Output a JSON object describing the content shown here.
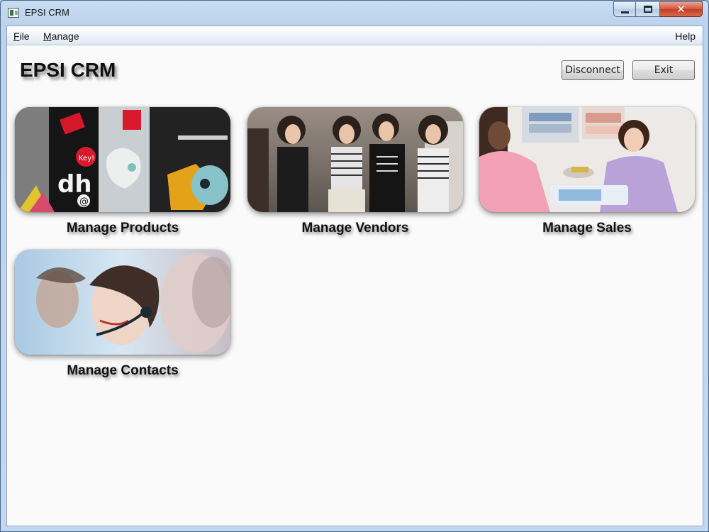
{
  "window": {
    "title": "EPSI CRM"
  },
  "menu": {
    "file": "File",
    "manage": "Manage",
    "help": "Help"
  },
  "header": {
    "title": "EPSI CRM",
    "disconnect": "Disconnect",
    "exit": "Exit"
  },
  "tiles": [
    {
      "label": "Manage Products"
    },
    {
      "label": "Manage Vendors"
    },
    {
      "label": "Manage Sales"
    },
    {
      "label": "Manage Contacts"
    }
  ],
  "icons": {
    "minimize": "minimize-icon",
    "maximize": "maximize-icon",
    "close": "close-icon"
  },
  "product_shirt_texts": {
    "tag": "Key!",
    "graphic": "dh",
    "letter": "@"
  },
  "colors": {
    "accent_close": "#c33d22",
    "titlebar": "#bcd3ec"
  }
}
